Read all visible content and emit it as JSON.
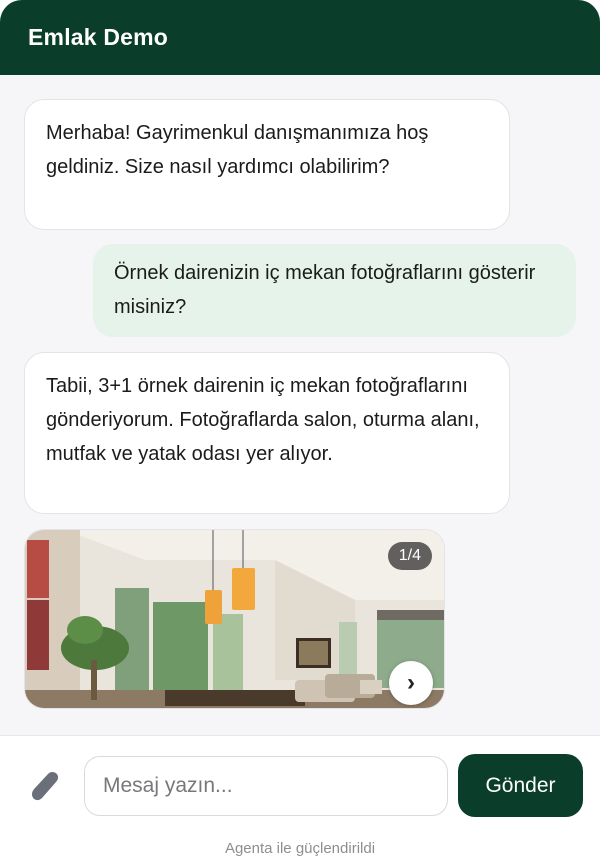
{
  "header": {
    "title": "Emlak Demo"
  },
  "messages": [
    {
      "from": "bot",
      "text": "Merhaba! Gayrimenkul danışmanımıza hoş geldiniz. Size nasıl yardımcı olabilirim?"
    },
    {
      "from": "user",
      "text": "Örnek dairenizin iç mekan fotoğraflarını gösterir misiniz?"
    },
    {
      "from": "bot",
      "text": "Tabii, 3+1 örnek dairenin iç mekan fotoğraflarını gönderiyorum. Fotoğraflarda salon, oturma alanı, mutfak ve yatak odası yer alıyor."
    }
  ],
  "gallery": {
    "counter": "1/4",
    "next_icon": "›"
  },
  "composer": {
    "placeholder": "Mesaj yazın...",
    "send_label": "Gönder",
    "attach_icon": "paperclip-icon"
  },
  "footer": {
    "powered_by": "Agenta ile güçlendirildi"
  },
  "colors": {
    "brand": "#0b3d2b",
    "user_bubble": "#e6f3ea",
    "bot_bubble": "#ffffff",
    "background": "#f6f6f8"
  }
}
